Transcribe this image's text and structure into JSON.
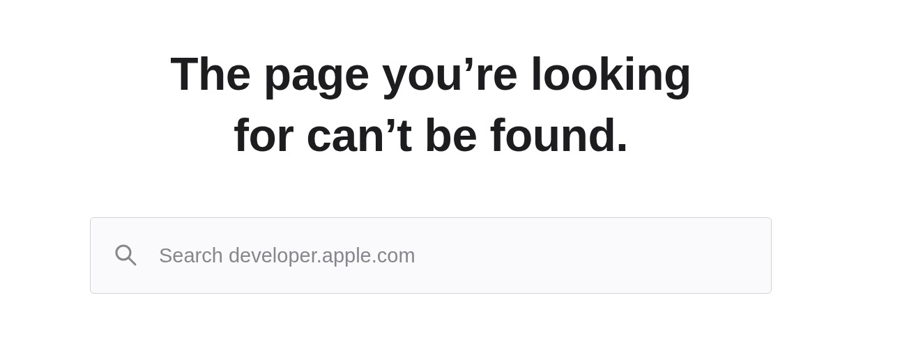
{
  "heading": "The page you’re looking for can’t be found.",
  "search": {
    "placeholder": "Search developer.apple.com"
  }
}
